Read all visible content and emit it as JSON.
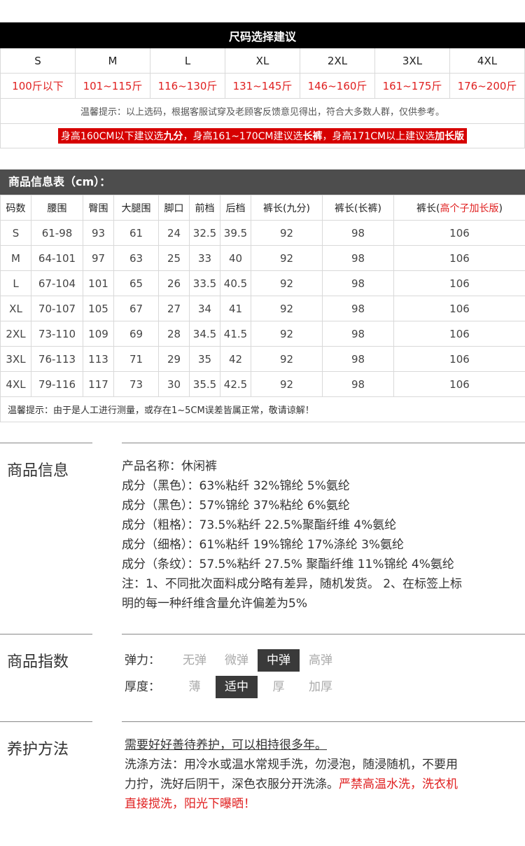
{
  "size_chart": {
    "title": "尺码选择建议",
    "sizes": [
      "S",
      "M",
      "L",
      "XL",
      "2XL",
      "3XL",
      "4XL"
    ],
    "weights": [
      "100斤以下",
      "101~115斤",
      "116~130斤",
      "131~145斤",
      "146~160斤",
      "161~175斤",
      "176~200斤"
    ],
    "tip": "温馨提示：以上选码，根据客服试穿及老顾客反馈意见得出，符合大多数人群，仅供参考。",
    "rec_1": "身高160CM以下建议选",
    "rec_1b": "九分",
    "rec_2": "，身高161~170CM建议选",
    "rec_2b": "长裤",
    "rec_3": "，身高171CM以上建议选",
    "rec_3b": "加长版"
  },
  "product_info": {
    "header": "商品信息表（cm）：",
    "columns": [
      "码数",
      "腰围",
      "臀围",
      "大腿围",
      "脚口",
      "前档",
      "后档",
      "裤长(九分)",
      "裤长(长裤)"
    ],
    "last_col_prefix": "裤长(",
    "last_col_red": "高个子加长版",
    "last_col_suffix": ")",
    "rows": [
      [
        "S",
        "61-98",
        "93",
        "61",
        "24",
        "32.5",
        "39.5",
        "92",
        "98",
        "106"
      ],
      [
        "M",
        "64-101",
        "97",
        "63",
        "25",
        "33",
        "40",
        "92",
        "98",
        "106"
      ],
      [
        "L",
        "67-104",
        "101",
        "65",
        "26",
        "33.5",
        "40.5",
        "92",
        "98",
        "106"
      ],
      [
        "XL",
        "70-107",
        "105",
        "67",
        "27",
        "34",
        "41",
        "92",
        "98",
        "106"
      ],
      [
        "2XL",
        "73-110",
        "109",
        "69",
        "28",
        "34.5",
        "41.5",
        "92",
        "98",
        "106"
      ],
      [
        "3XL",
        "76-113",
        "113",
        "71",
        "29",
        "35",
        "42",
        "92",
        "98",
        "106"
      ],
      [
        "4XL",
        "79-116",
        "117",
        "73",
        "30",
        "35.5",
        "42.5",
        "92",
        "98",
        "106"
      ]
    ],
    "note": "温馨提示：由于是人工进行测量，或存在1~5CM误差皆属正常，敬请谅解！"
  },
  "details": {
    "title": "商品信息",
    "lines": [
      " 产品名称：休闲裤",
      "成分（黑色）：63%粘纤 32%锦纶 5%氨纶",
      "成分（黑色）：57%锦纶 37%粘纶 6%氨纶",
      "成分（粗格）：73.5%粘纤 22.5%聚酯纤维 4%氨纶",
      "成分（细格）：61%粘纤 19%锦纶 17%涤纶 3%氨纶",
      "成分（条纹）：57.5%粘纤 27.5% 聚酯纤维 11%锦纶 4%氨纶",
      "注：1、不同批次面料成分略有差异，随机发货。 2、在标签上标",
      "明的每一种纤维含量允许偏差为5%"
    ]
  },
  "indices": {
    "title": "商品指数",
    "elastic_label": "弹力：",
    "elastic_options": [
      "无弹",
      "微弹",
      "中弹",
      "高弹"
    ],
    "elastic_selected": "中弹",
    "thickness_label": "厚度：",
    "thickness_options": [
      "薄",
      "适中",
      "厚",
      "加厚"
    ],
    "thickness_selected": "适中"
  },
  "care": {
    "title": "养护方法",
    "heading": "需要好好善待养护，可以相持很多年。",
    "line1": "洗涤方法：用冷水或温水常规手洗，勿浸泡，随浸随机，不要用",
    "line2_a": "力拧，洗好后阴干，深色衣服分开洗涤。",
    "line2_b": "严禁高温水洗，洗衣机",
    "line3": "直接搅洗，阳光下曝晒！"
  },
  "colors": {
    "red": "#e02020",
    "dark_header": "#4d4d4d",
    "black_header": "#000000"
  }
}
